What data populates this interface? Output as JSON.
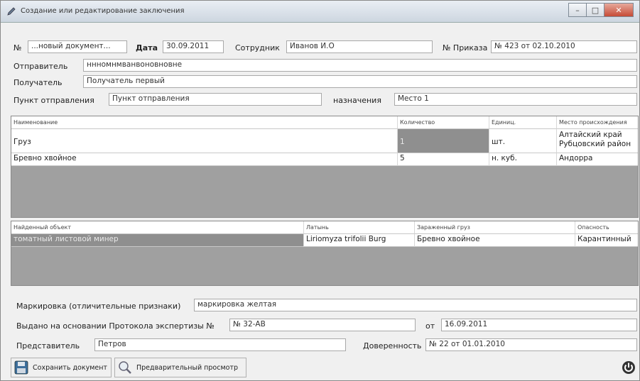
{
  "window": {
    "title": "Создание или редактирование заключения",
    "buttons": {
      "minimize": "–",
      "maximize": "□",
      "close": "✕"
    }
  },
  "form": {
    "number_label": "№",
    "number_value": "...новый документ...",
    "date_label": "Дата",
    "date_value": "30.09.2011",
    "employee_label": "Сотрудник",
    "employee_value": "Иванов И.О",
    "order_label": "№ Приказа",
    "order_value": "№ 423 от 02.10.2010",
    "sender_label": "Отправитель",
    "sender_value": "ннномнмванвоновновне",
    "recipient_label": "Получатель",
    "recipient_value": "Получатель первый",
    "origin_label": "Пункт отправления",
    "origin_value": "Пункт отправления",
    "destination_label": "назначения",
    "destination_value": "Место 1"
  },
  "cargo_table": {
    "headers": [
      "Наименование",
      "Количество",
      "Единиц.",
      "Место происхождения"
    ],
    "rows": [
      {
        "name": "Груз",
        "qty": "1",
        "unit": "шт.",
        "origin_line1": "Алтайский край",
        "origin_line2": "Рубцовский район"
      },
      {
        "name": "Бревно хвойное",
        "qty": "5",
        "unit": "н. куб.",
        "origin_line1": "Андорра",
        "origin_line2": ""
      }
    ]
  },
  "objects_table": {
    "headers": [
      "Найденный объект",
      "Латынь",
      "Зараженный груз",
      "Опасность"
    ],
    "rows": [
      {
        "object": "томатный листовой минер",
        "latin": "Liriomyza trifolii Burg",
        "cargo": "Бревно хвойное",
        "danger": "Карантинный"
      }
    ]
  },
  "footer_form": {
    "marking_label": "Маркировка (отличительные признаки)",
    "marking_value": "маркировка желтая",
    "issued_label": "Выдано на основании Протокола экспертизы №",
    "issued_value": "№ 32-АВ",
    "issued_date_label": "от",
    "issued_date_value": "16.09.2011",
    "rep_label": "Представитель",
    "rep_value": "Петров",
    "proxy_label": "Доверенность",
    "proxy_value": "№ 22 от 01.01.2010"
  },
  "actions": {
    "save_label": "Сохранить документ",
    "preview_label": "Предварительный просмотр"
  },
  "icons": {
    "title": "pen-icon",
    "save": "floppy-disk-icon",
    "preview": "magnifier-icon",
    "power": "power-icon"
  }
}
